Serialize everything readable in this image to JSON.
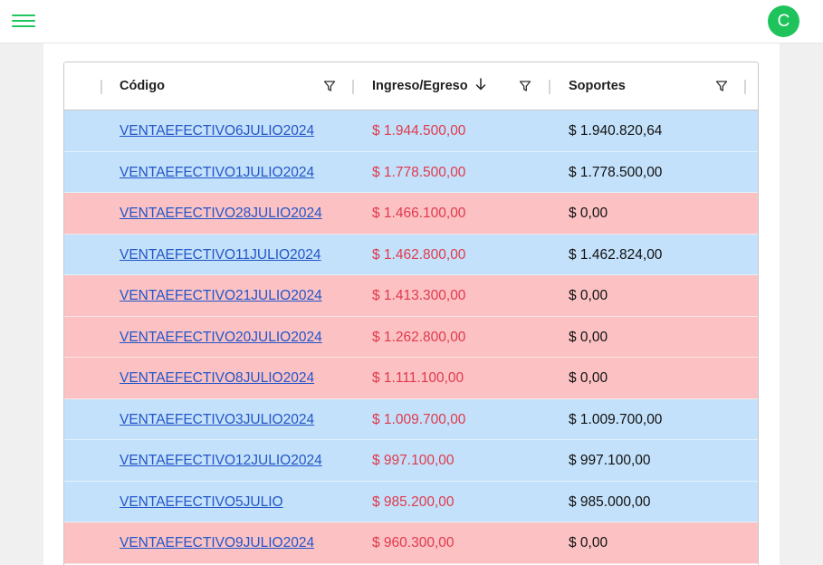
{
  "topbar": {
    "menu_icon": "hamburger-menu-icon",
    "avatar_initial": "C"
  },
  "table": {
    "columns": [
      {
        "label": "Código",
        "filter_icon": "filter-icon"
      },
      {
        "label": "Ingreso/Egreso",
        "sort_icon": "arrow-down-icon",
        "filter_icon": "filter-icon"
      },
      {
        "label": "Soportes",
        "filter_icon": "filter-icon"
      }
    ],
    "rows": [
      {
        "codigo": "VENTAEFECTIVO6JULIO2024",
        "ingreso": "$ 1.944.500,00",
        "soportes": "$ 1.940.820,64",
        "status": "blue"
      },
      {
        "codigo": "VENTAEFECTIVO1JULIO2024",
        "ingreso": "$ 1.778.500,00",
        "soportes": "$ 1.778.500,00",
        "status": "blue"
      },
      {
        "codigo": "VENTAEFECTIVO28JULIO2024",
        "ingreso": "$ 1.466.100,00",
        "soportes": "$ 0,00",
        "status": "red"
      },
      {
        "codigo": "VENTAEFECTIVO11JULIO2024",
        "ingreso": "$ 1.462.800,00",
        "soportes": "$ 1.462.824,00",
        "status": "blue"
      },
      {
        "codigo": "VENTAEFECTIVO21JULIO2024",
        "ingreso": "$ 1.413.300,00",
        "soportes": "$ 0,00",
        "status": "red"
      },
      {
        "codigo": "VENTAEFECTIVO20JULIO2024",
        "ingreso": "$ 1.262.800,00",
        "soportes": "$ 0,00",
        "status": "red"
      },
      {
        "codigo": "VENTAEFECTIVO8JULIO2024",
        "ingreso": "$ 1.111.100,00",
        "soportes": "$ 0,00",
        "status": "red"
      },
      {
        "codigo": "VENTAEFECTIVO3JULIO2024",
        "ingreso": "$ 1.009.700,00",
        "soportes": "$ 1.009.700,00",
        "status": "blue"
      },
      {
        "codigo": "VENTAEFECTIVO12JULIO2024",
        "ingreso": "$ 997.100,00",
        "soportes": "$ 997.100,00",
        "status": "blue"
      },
      {
        "codigo": "VENTAEFECTIVO5JULIO",
        "ingreso": "$ 985.200,00",
        "soportes": "$ 985.000,00",
        "status": "blue"
      },
      {
        "codigo": "VENTAEFECTIVO9JULIO2024",
        "ingreso": "$ 960.300,00",
        "soportes": "$ 0,00",
        "status": "red"
      }
    ]
  },
  "colors": {
    "brand_green": "#21c55d",
    "row_blue": "#c3e1fa",
    "row_red": "#fcc1c3",
    "link_blue": "#2356c8",
    "amount_red": "#e03a4d"
  }
}
